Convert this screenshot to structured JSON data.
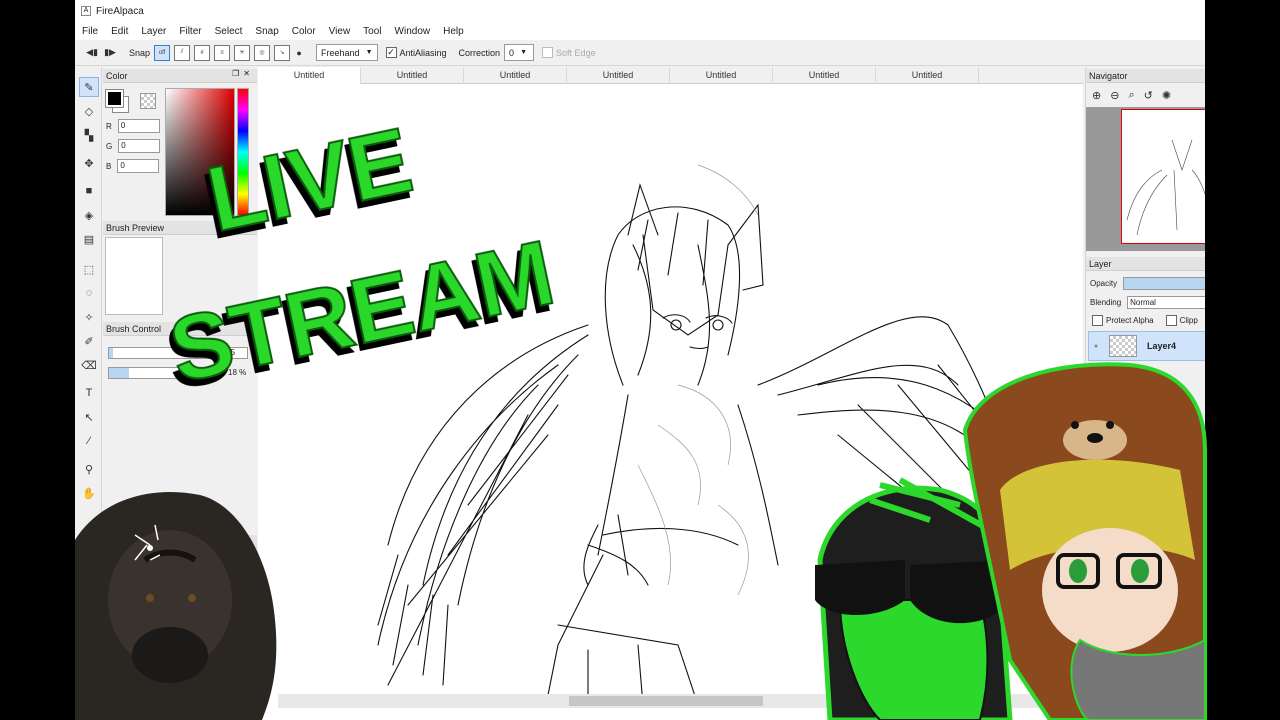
{
  "app": {
    "title": "FireAlpaca"
  },
  "menu": [
    "File",
    "Edit",
    "Layer",
    "Filter",
    "Select",
    "Snap",
    "Color",
    "View",
    "Tool",
    "Window",
    "Help"
  ],
  "toolbar": {
    "snap_label": "Snap",
    "snap_off": "off",
    "brush_mode": "Freehand",
    "antialiasing_label": "AntiAliasing",
    "antialiasing_checked": true,
    "correction_label": "Correction",
    "correction_value": "0",
    "soft_edge_label": "Soft Edge",
    "soft_edge_checked": false
  },
  "tools": [
    "pen-icon",
    "eraser-icon",
    "dot-icon",
    "move-icon",
    "fill-icon",
    "bucket-icon",
    "gradient-icon",
    "select-rect-icon",
    "lasso-icon",
    "magic-wand-icon",
    "select-pen-icon",
    "select-eraser-icon",
    "text-icon",
    "operation-icon",
    "divide-icon",
    "eyedropper-icon",
    "hand-icon"
  ],
  "color_panel": {
    "title": "Color",
    "r_label": "R",
    "r_value": "0",
    "g_label": "G",
    "g_value": "0",
    "b_label": "B",
    "b_value": "0",
    "foreground": "#000000",
    "background": "#ffffff"
  },
  "brush_preview": {
    "title": "Brush Preview"
  },
  "brush_control": {
    "title": "Brush Control",
    "size_value": "3.5",
    "size_fraction": 0.04,
    "opacity_value": "18 %",
    "opacity_fraction": 0.18
  },
  "tabs": [
    "Untitled",
    "Untitled",
    "Untitled",
    "Untitled",
    "Untitled",
    "Untitled",
    "Untitled"
  ],
  "navigator": {
    "title": "Navigator"
  },
  "layer_panel": {
    "title": "Layer",
    "opacity_label": "Opacity",
    "blending_label": "Blending",
    "blending_value": "Normal",
    "protect_alpha_label": "Protect Alpha",
    "clipping_label": "Clipp",
    "layer_name": "Layer4"
  },
  "overlay": {
    "line1": "LIVE",
    "line2": "STREAM"
  },
  "colors": {
    "accent": "#3a7bd5",
    "overlay_green": "#2bd82b",
    "selected_blue": "#cfe3fb"
  }
}
